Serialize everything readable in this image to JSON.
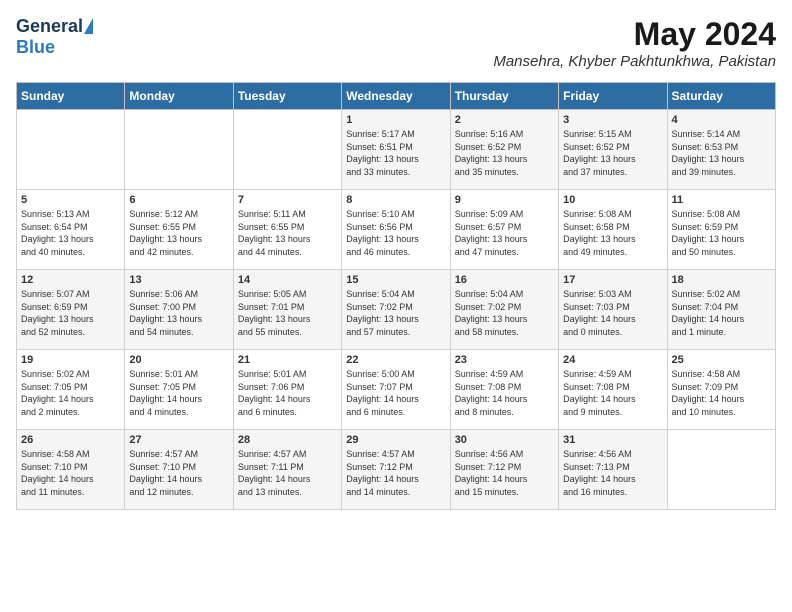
{
  "logo": {
    "general": "General",
    "blue": "Blue"
  },
  "title": {
    "month_year": "May 2024",
    "location": "Mansehra, Khyber Pakhtunkhwa, Pakistan"
  },
  "headers": [
    "Sunday",
    "Monday",
    "Tuesday",
    "Wednesday",
    "Thursday",
    "Friday",
    "Saturday"
  ],
  "weeks": [
    [
      {
        "day": "",
        "content": ""
      },
      {
        "day": "",
        "content": ""
      },
      {
        "day": "",
        "content": ""
      },
      {
        "day": "1",
        "content": "Sunrise: 5:17 AM\nSunset: 6:51 PM\nDaylight: 13 hours\nand 33 minutes."
      },
      {
        "day": "2",
        "content": "Sunrise: 5:16 AM\nSunset: 6:52 PM\nDaylight: 13 hours\nand 35 minutes."
      },
      {
        "day": "3",
        "content": "Sunrise: 5:15 AM\nSunset: 6:52 PM\nDaylight: 13 hours\nand 37 minutes."
      },
      {
        "day": "4",
        "content": "Sunrise: 5:14 AM\nSunset: 6:53 PM\nDaylight: 13 hours\nand 39 minutes."
      }
    ],
    [
      {
        "day": "5",
        "content": "Sunrise: 5:13 AM\nSunset: 6:54 PM\nDaylight: 13 hours\nand 40 minutes."
      },
      {
        "day": "6",
        "content": "Sunrise: 5:12 AM\nSunset: 6:55 PM\nDaylight: 13 hours\nand 42 minutes."
      },
      {
        "day": "7",
        "content": "Sunrise: 5:11 AM\nSunset: 6:55 PM\nDaylight: 13 hours\nand 44 minutes."
      },
      {
        "day": "8",
        "content": "Sunrise: 5:10 AM\nSunset: 6:56 PM\nDaylight: 13 hours\nand 46 minutes."
      },
      {
        "day": "9",
        "content": "Sunrise: 5:09 AM\nSunset: 6:57 PM\nDaylight: 13 hours\nand 47 minutes."
      },
      {
        "day": "10",
        "content": "Sunrise: 5:08 AM\nSunset: 6:58 PM\nDaylight: 13 hours\nand 49 minutes."
      },
      {
        "day": "11",
        "content": "Sunrise: 5:08 AM\nSunset: 6:59 PM\nDaylight: 13 hours\nand 50 minutes."
      }
    ],
    [
      {
        "day": "12",
        "content": "Sunrise: 5:07 AM\nSunset: 6:59 PM\nDaylight: 13 hours\nand 52 minutes."
      },
      {
        "day": "13",
        "content": "Sunrise: 5:06 AM\nSunset: 7:00 PM\nDaylight: 13 hours\nand 54 minutes."
      },
      {
        "day": "14",
        "content": "Sunrise: 5:05 AM\nSunset: 7:01 PM\nDaylight: 13 hours\nand 55 minutes."
      },
      {
        "day": "15",
        "content": "Sunrise: 5:04 AM\nSunset: 7:02 PM\nDaylight: 13 hours\nand 57 minutes."
      },
      {
        "day": "16",
        "content": "Sunrise: 5:04 AM\nSunset: 7:02 PM\nDaylight: 13 hours\nand 58 minutes."
      },
      {
        "day": "17",
        "content": "Sunrise: 5:03 AM\nSunset: 7:03 PM\nDaylight: 14 hours\nand 0 minutes."
      },
      {
        "day": "18",
        "content": "Sunrise: 5:02 AM\nSunset: 7:04 PM\nDaylight: 14 hours\nand 1 minute."
      }
    ],
    [
      {
        "day": "19",
        "content": "Sunrise: 5:02 AM\nSunset: 7:05 PM\nDaylight: 14 hours\nand 2 minutes."
      },
      {
        "day": "20",
        "content": "Sunrise: 5:01 AM\nSunset: 7:05 PM\nDaylight: 14 hours\nand 4 minutes."
      },
      {
        "day": "21",
        "content": "Sunrise: 5:01 AM\nSunset: 7:06 PM\nDaylight: 14 hours\nand 6 minutes."
      },
      {
        "day": "22",
        "content": "Sunrise: 5:00 AM\nSunset: 7:07 PM\nDaylight: 14 hours\nand 6 minutes."
      },
      {
        "day": "23",
        "content": "Sunrise: 4:59 AM\nSunset: 7:08 PM\nDaylight: 14 hours\nand 8 minutes."
      },
      {
        "day": "24",
        "content": "Sunrise: 4:59 AM\nSunset: 7:08 PM\nDaylight: 14 hours\nand 9 minutes."
      },
      {
        "day": "25",
        "content": "Sunrise: 4:58 AM\nSunset: 7:09 PM\nDaylight: 14 hours\nand 10 minutes."
      }
    ],
    [
      {
        "day": "26",
        "content": "Sunrise: 4:58 AM\nSunset: 7:10 PM\nDaylight: 14 hours\nand 11 minutes."
      },
      {
        "day": "27",
        "content": "Sunrise: 4:57 AM\nSunset: 7:10 PM\nDaylight: 14 hours\nand 12 minutes."
      },
      {
        "day": "28",
        "content": "Sunrise: 4:57 AM\nSunset: 7:11 PM\nDaylight: 14 hours\nand 13 minutes."
      },
      {
        "day": "29",
        "content": "Sunrise: 4:57 AM\nSunset: 7:12 PM\nDaylight: 14 hours\nand 14 minutes."
      },
      {
        "day": "30",
        "content": "Sunrise: 4:56 AM\nSunset: 7:12 PM\nDaylight: 14 hours\nand 15 minutes."
      },
      {
        "day": "31",
        "content": "Sunrise: 4:56 AM\nSunset: 7:13 PM\nDaylight: 14 hours\nand 16 minutes."
      },
      {
        "day": "",
        "content": ""
      }
    ]
  ]
}
